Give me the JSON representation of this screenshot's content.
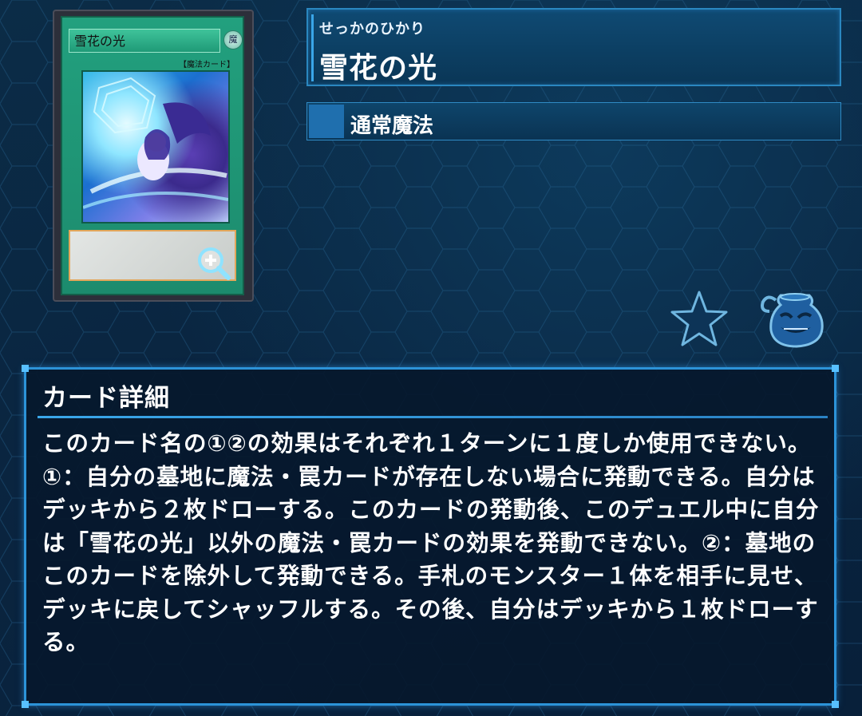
{
  "card": {
    "art_name": "雪花の光",
    "attribute_glyph": "魔",
    "type_line": "【魔法カード】",
    "name_ruby": "せっかのひかり",
    "name": "雪花の光",
    "spell_type": "通常魔法"
  },
  "icons": {
    "zoom": "zoom-in-icon",
    "favorite": "star-icon",
    "pot": "pot-of-greed-icon"
  },
  "details": {
    "heading": "カード詳細",
    "effect_text": "このカード名の①②の効果はそれぞれ１ターンに１度しか使用できない。①：自分の墓地に魔法・罠カードが存在しない場合に発動できる。自分はデッキから２枚ドローする。このカードの発動後、このデュエル中に自分は「雪花の光」以外の魔法・罠カードの効果を発動できない。②：墓地のこのカードを除外して発動できる。手札のモンスター１体を相手に見せ、デッキに戻してシャッフルする。その後、自分はデッキから１枚ドローする。"
  },
  "colors": {
    "panel_border": "#2c93d8",
    "card_green": "#22a07e",
    "background": "#0a2540"
  }
}
